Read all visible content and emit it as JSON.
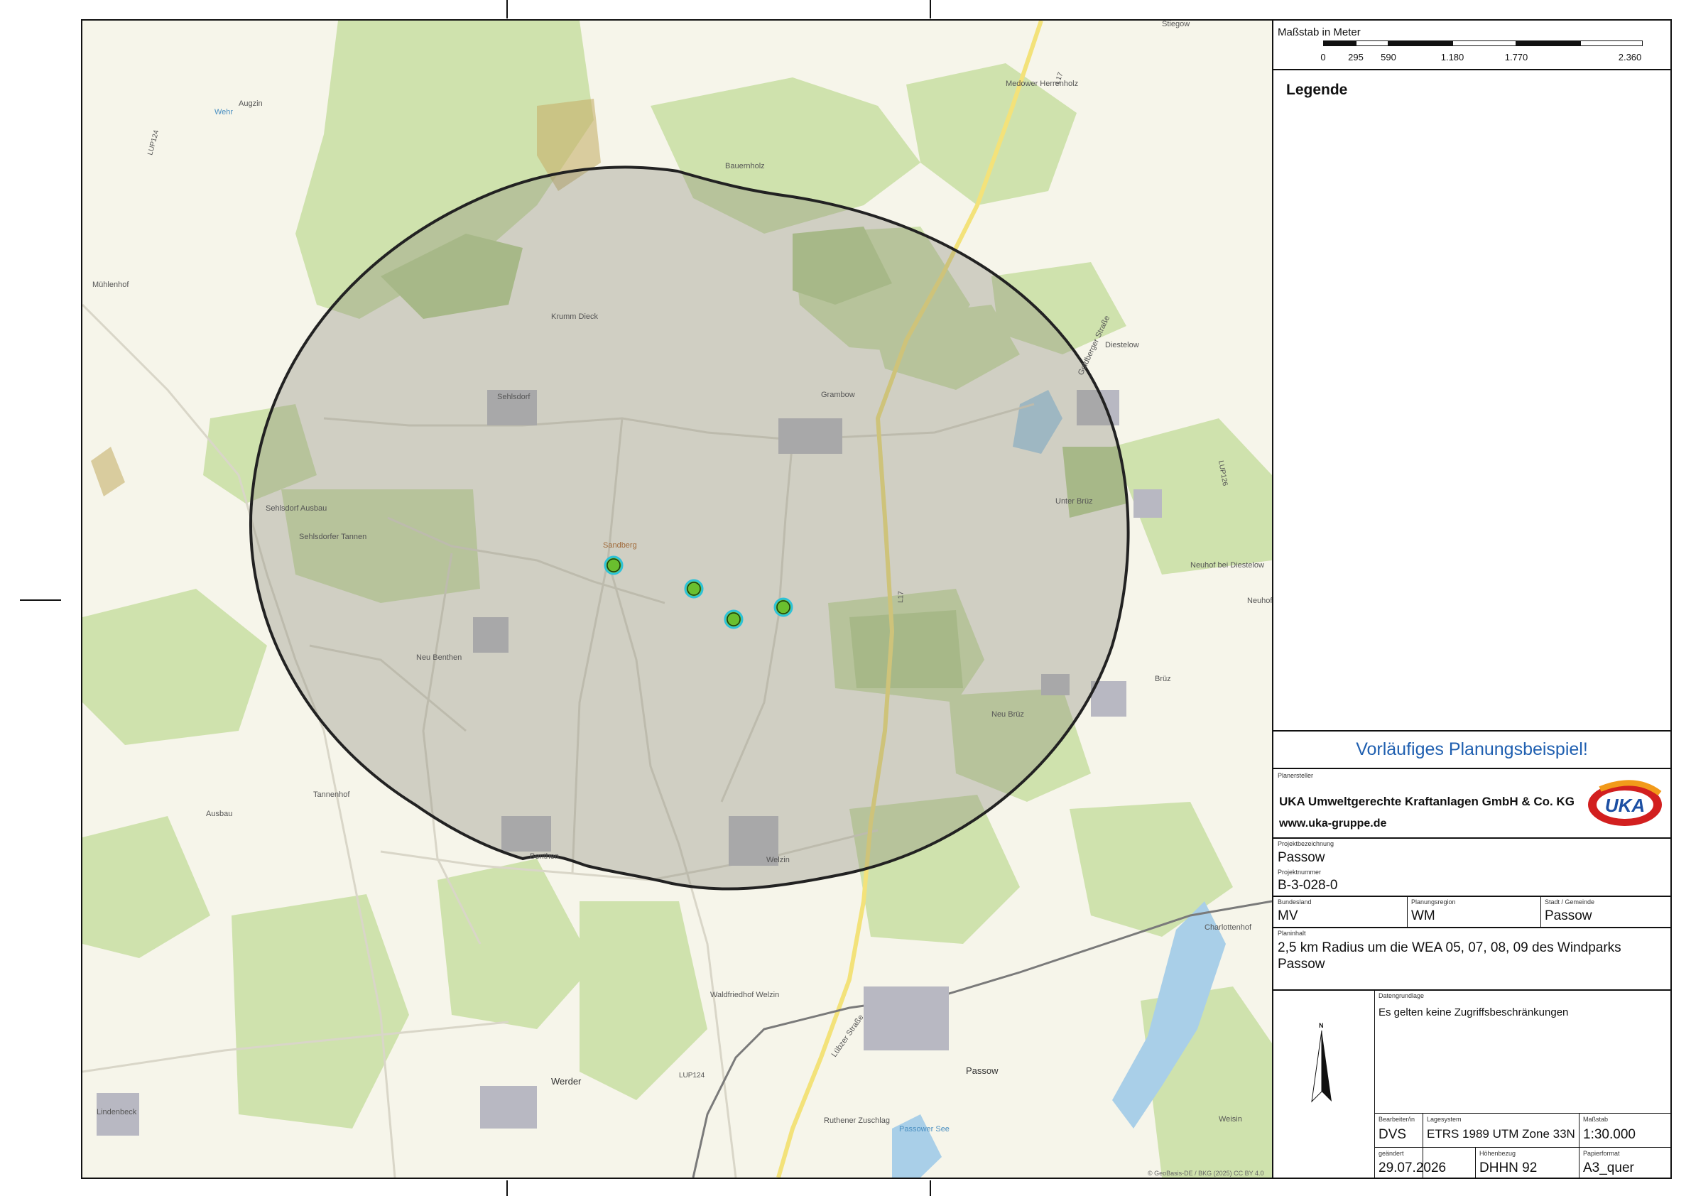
{
  "map": {
    "places": {
      "augzin": "Augzin",
      "wehr": "Wehr",
      "muehlenhof": "Mühlenhof",
      "krumm_dieck": "Krumm Dieck",
      "sehlsdorf": "Sehlsdorf",
      "sehlsdorf_ausbau": "Sehlsdorf Ausbau",
      "sehlsdorfer_tannen": "Sehlsdorfer Tannen",
      "sandberg": "Sandberg",
      "neu_benthen": "Neu Benthen",
      "tannenhof": "Tannenhof",
      "ausbau": "Ausbau",
      "benthen": "Benthen",
      "welzin": "Welzin",
      "waldfriedhof": "Waldfriedhof Welzin",
      "lindenbeck": "Lindenbeck",
      "werder": "Werder",
      "grambow": "Grambow",
      "bauernholz": "Bauernholz",
      "medower_herrenholz": "Medower Herrenholz",
      "diestelow": "Diestelow",
      "unter_bruez": "Unter Brüz",
      "neuhof_bei_diestelow": "Neuhof bei Diestelow",
      "neuhof": "Neuhof",
      "bruez": "Brüz",
      "neu_bruez": "Neu Brüz",
      "charlottenhof": "Charlottenhof",
      "passow": "Passow",
      "ruthener_zuschlag": "Ruthener Zuschlag",
      "passower_see": "Passower See",
      "weisin": "Weisin",
      "goldberger_strasse": "Goldberger Straße",
      "luebzer_strasse": "Lübzer Straße",
      "stiegow": "Stiegow"
    },
    "roads": {
      "lup124": "LUP124",
      "l17": "L17",
      "lup126": "LUP126"
    },
    "attribution": "© GeoBasis-DE / BKG (2025) CC BY 4.0",
    "radius_km": 2.5,
    "turbines": [
      "WEA 05",
      "WEA 07",
      "WEA 08",
      "WEA 09"
    ],
    "colors": {
      "base": "#f6f5ea",
      "forest": "#cfe2ad",
      "forest_dark": "#b7d28f",
      "water": "#a9cfe8",
      "buffer": "#8a8a7a",
      "turbine_fill": "#6abf2e",
      "turbine_ring": "#2ec2d8",
      "road_main": "#f3e27a",
      "rail": "#7a7a7a"
    }
  },
  "panel": {
    "scale_title": "Maßstab in Meter",
    "scale_ticks": [
      "0",
      "295",
      "590",
      "1.180",
      "1.770",
      "2.360"
    ],
    "legend_title": "Legende",
    "banner": "Vorläufiges Planungsbeispiel!",
    "planersteller_label": "Planersteller",
    "company": "UKA Umweltgerechte Kraftanlagen GmbH & Co. KG",
    "website": "www.uka-gruppe.de",
    "logo_text": "UKA",
    "projektbezeichnung_label": "Projektbezeichnung",
    "projektbezeichnung": "Passow",
    "projektnummer_label": "Projektnummer",
    "projektnummer": "B-3-028-0",
    "bundesland_label": "Bundesland",
    "bundesland": "MV",
    "planungsregion_label": "Planungsregion",
    "planungsregion": "WM",
    "gemeinde_label": "Stadt / Gemeinde",
    "gemeinde": "Passow",
    "planinhalt_label": "Planinhalt",
    "planinhalt": "2,5 km Radius um die WEA 05, 07, 08, 09 des Windparks Passow",
    "datengrundlage_label": "Datengrundlage",
    "datengrundlage": "Es gelten keine Zugriffsbeschränkungen",
    "north_label": "N",
    "bearbeiter_label": "Bearbeiter/in",
    "bearbeiter": "DVS",
    "lagesystem_label": "Lagesystem",
    "lagesystem": "ETRS 1989 UTM Zone 33N",
    "massstab_label": "Maßstab",
    "massstab": "1:30.000",
    "geaendert_label": "geändert",
    "geaendert": "29.07.2026",
    "hoehenbezug_label": "Höhenbezug",
    "hoehenbezug": "DHHN 92",
    "papierformat_label": "Papierformat",
    "papierformat": "A3_quer"
  }
}
